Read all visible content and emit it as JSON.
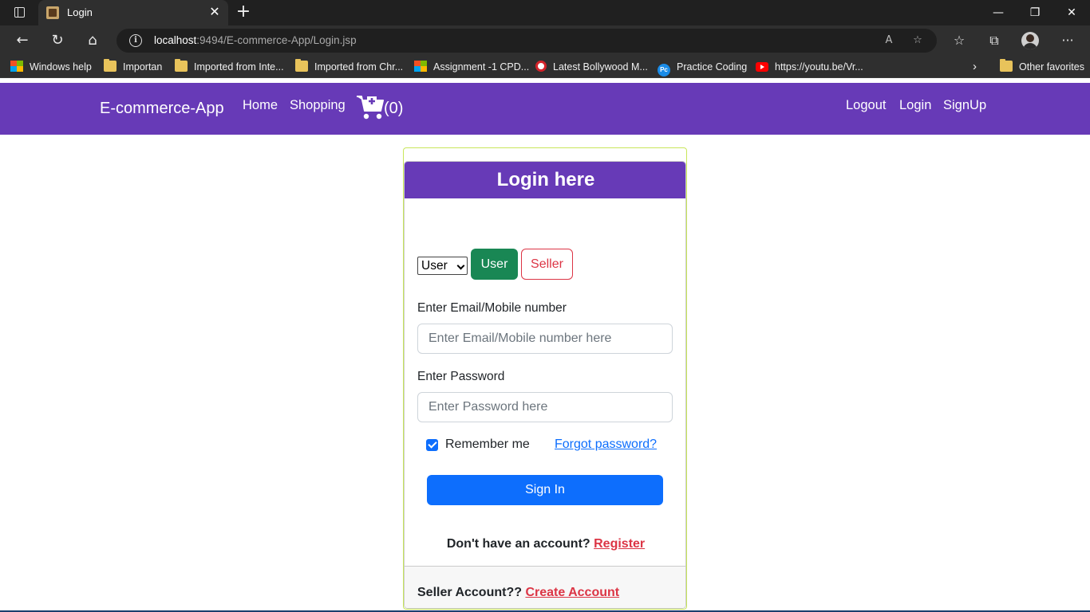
{
  "browser": {
    "tab_title": "Login",
    "url_host": "localhost",
    "url_path": ":9494/E-commerce-App/Login.jsp",
    "bookmarks": [
      "Windows help",
      "Importan",
      "Imported from Inte...",
      "Imported from Chr...",
      "Assignment -1 CPD...",
      "Latest Bollywood M...",
      "Practice Coding",
      "https://youtu.be/Vr...",
      "Other favorites"
    ]
  },
  "navbar": {
    "brand": "E-commerce-App",
    "home": "Home",
    "shopping": "Shopping",
    "cart_count": "(0)",
    "logout": "Logout",
    "login": "Login",
    "signup": "SignUp",
    "color": "#673ab7"
  },
  "login": {
    "title": "Login here",
    "role_selected": "User",
    "btn_user": "User",
    "btn_seller": "Seller",
    "email_label": "Enter Email/Mobile number",
    "email_placeholder": "Enter Email/Mobile number here",
    "password_label": "Enter Password",
    "password_placeholder": "Enter Password here",
    "remember": "Remember me",
    "remember_checked": true,
    "forgot": "Forgot password?",
    "signin": "Sign In",
    "no_account": "Don't have an account?",
    "register": "Register",
    "seller_account": "Seller Account??",
    "create_account": "Create Account"
  }
}
